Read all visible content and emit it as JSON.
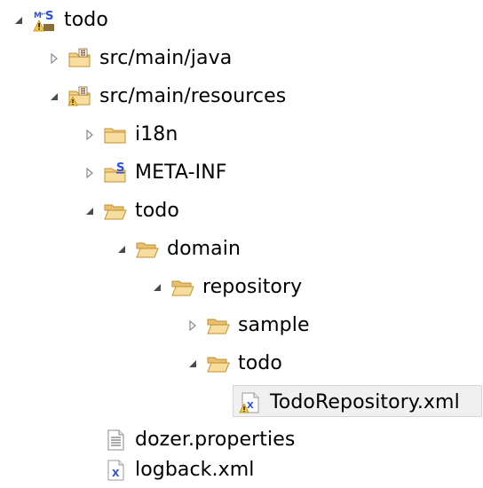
{
  "tree": {
    "nodes": [
      {
        "label": "todo",
        "icon": "maven-project-icon",
        "toggle": "expanded"
      },
      {
        "label": "src/main/java",
        "icon": "source-folder-icon",
        "toggle": "collapsed"
      },
      {
        "label": "src/main/resources",
        "icon": "source-folder-icon",
        "toggle": "expanded"
      },
      {
        "label": "i18n",
        "icon": "folder-icon",
        "toggle": "collapsed"
      },
      {
        "label": "META-INF",
        "icon": "spring-folder-icon",
        "toggle": "collapsed"
      },
      {
        "label": "todo",
        "icon": "open-folder-icon",
        "toggle": "expanded"
      },
      {
        "label": "domain",
        "icon": "open-folder-icon",
        "toggle": "expanded"
      },
      {
        "label": "repository",
        "icon": "open-folder-icon",
        "toggle": "expanded"
      },
      {
        "label": "sample",
        "icon": "open-folder-icon",
        "toggle": "collapsed"
      },
      {
        "label": "todo",
        "icon": "open-folder-icon",
        "toggle": "expanded"
      },
      {
        "label": "TodoRepository.xml",
        "icon": "xml-file-icon",
        "toggle": "none",
        "selected": true
      },
      {
        "label": "dozer.properties",
        "icon": "properties-file-icon",
        "toggle": "none"
      },
      {
        "label": "logback.xml",
        "icon": "xml-file-icon",
        "toggle": "none"
      }
    ]
  },
  "colors": {
    "folder_fill": "#f3d38a",
    "folder_stroke": "#c29030",
    "spring_blue": "#2c4fd8",
    "selection_bg": "#f0f0f0",
    "selection_border": "#d4d4d4",
    "warning_yellow": "#f5c842"
  }
}
